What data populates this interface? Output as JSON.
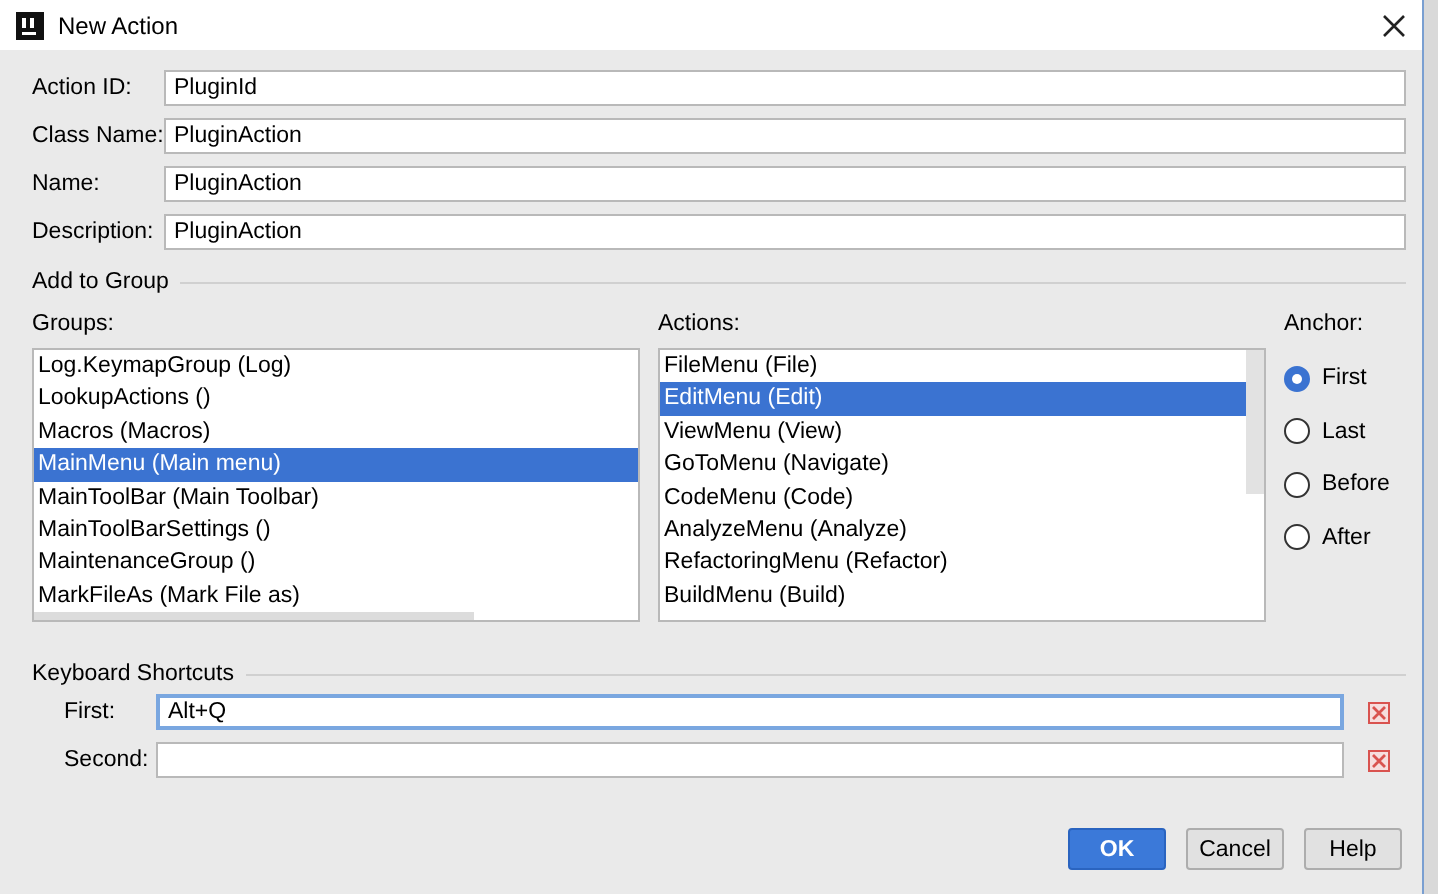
{
  "window": {
    "title": "New Action"
  },
  "fields": [
    {
      "label": "Action ID:",
      "value": "PluginId"
    },
    {
      "label": "Class Name:",
      "value": "PluginAction"
    },
    {
      "label": "Name:",
      "value": "PluginAction"
    },
    {
      "label": "Description:",
      "value": "PluginAction"
    }
  ],
  "add_to_group": {
    "title": "Add to Group",
    "groups": {
      "label": "Groups:",
      "items": [
        {
          "text": "Log.KeymapGroup (Log)",
          "selected": false
        },
        {
          "text": "LookupActions ()",
          "selected": false
        },
        {
          "text": "Macros (Macros)",
          "selected": false
        },
        {
          "text": "MainMenu (Main menu)",
          "selected": true
        },
        {
          "text": "MainToolBar (Main Toolbar)",
          "selected": false
        },
        {
          "text": "MainToolBarSettings ()",
          "selected": false
        },
        {
          "text": "MaintenanceGroup ()",
          "selected": false
        },
        {
          "text": "MarkFileAs (Mark File as)",
          "selected": false
        }
      ]
    },
    "actions": {
      "label": "Actions:",
      "items": [
        {
          "text": "FileMenu (File)",
          "selected": false
        },
        {
          "text": "EditMenu (Edit)",
          "selected": true
        },
        {
          "text": "ViewMenu (View)",
          "selected": false
        },
        {
          "text": "GoToMenu (Navigate)",
          "selected": false
        },
        {
          "text": "CodeMenu (Code)",
          "selected": false
        },
        {
          "text": "AnalyzeMenu (Analyze)",
          "selected": false
        },
        {
          "text": "RefactoringMenu (Refactor)",
          "selected": false
        },
        {
          "text": "BuildMenu (Build)",
          "selected": false
        }
      ]
    },
    "anchor": {
      "label": "Anchor:",
      "options": [
        {
          "label": "First",
          "selected": true
        },
        {
          "label": "Last",
          "selected": false
        },
        {
          "label": "Before",
          "selected": false
        },
        {
          "label": "After",
          "selected": false
        }
      ]
    }
  },
  "keyboard_shortcuts": {
    "title": "Keyboard Shortcuts",
    "rows": [
      {
        "label": "First:",
        "value": "Alt+Q",
        "focused": true
      },
      {
        "label": "Second:",
        "focused": false
      }
    ]
  },
  "buttons": [
    {
      "label": "OK",
      "default": true
    },
    {
      "label": "Cancel",
      "default": false
    },
    {
      "label": "Help",
      "default": false
    }
  ]
}
